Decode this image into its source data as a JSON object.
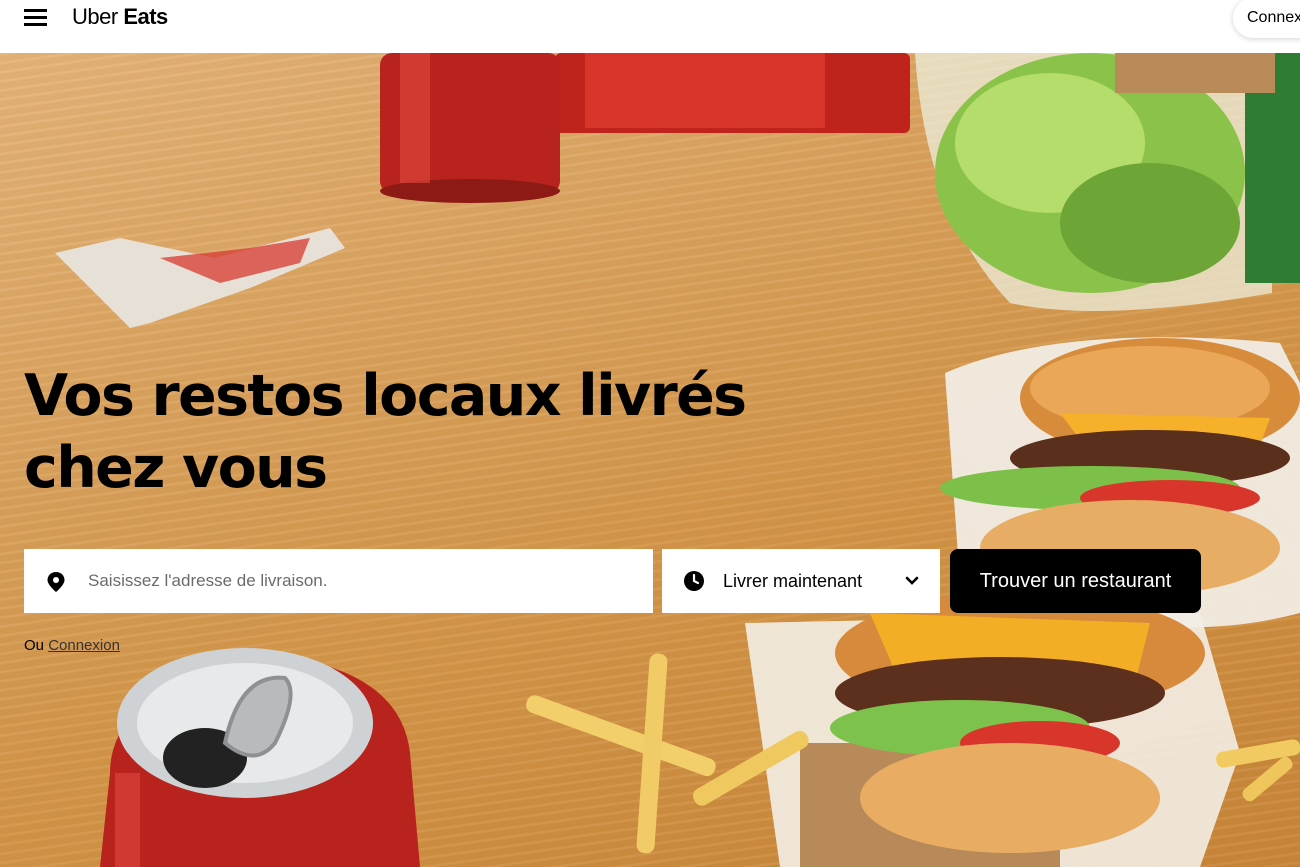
{
  "header": {
    "brand_part1": "Uber",
    "brand_part2": "Eats",
    "login_label": "Connexion"
  },
  "hero": {
    "headline": "Vos restos locaux livrés chez vous",
    "address": {
      "placeholder": "Saisissez l'adresse de livraison.",
      "value": ""
    },
    "delivery_time": {
      "selected": "Livrer maintenant"
    },
    "cta_label": "Trouver un restaurant",
    "alt_prefix": "Ou",
    "alt_link": "Connexion"
  },
  "icons": {
    "menu": "hamburger-menu-icon",
    "pin": "location-pin-icon",
    "clock": "clock-icon",
    "chevron": "chevron-down-icon"
  },
  "colors": {
    "primary": "#000000",
    "background": "#ffffff",
    "hero_wood": "#d9a15c"
  }
}
